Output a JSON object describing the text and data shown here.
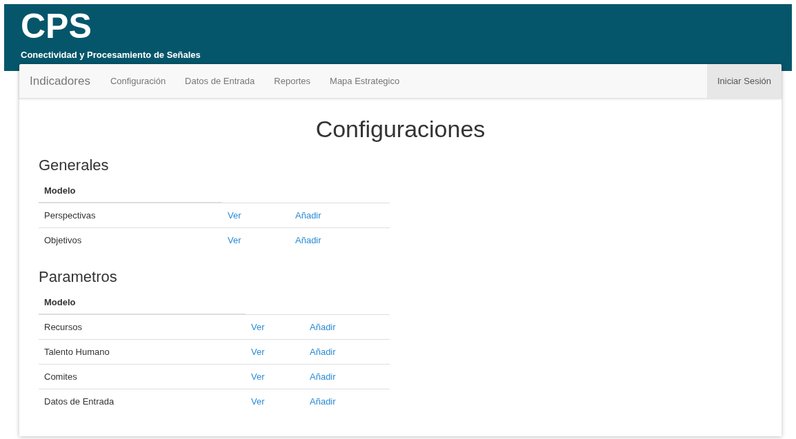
{
  "header": {
    "logo": "CPS",
    "subtitle": "Conectividad y Procesamiento de Señales"
  },
  "navbar": {
    "brand": "Indicadores",
    "items": [
      {
        "label": "Configuración",
        "selected": false
      },
      {
        "label": "Datos de Entrada",
        "selected": false
      },
      {
        "label": "Reportes",
        "selected": false
      },
      {
        "label": "Mapa Estrategico",
        "selected": false
      }
    ],
    "login": {
      "label": "Iniciar Sesión",
      "selected": true
    }
  },
  "page_title": "Configuraciones",
  "sections": [
    {
      "title": "Generales",
      "column": "Modelo",
      "rows": [
        {
          "name": "Perspectivas",
          "view": "Ver",
          "add": "Añadir"
        },
        {
          "name": "Objetivos",
          "view": "Ver",
          "add": "Añadir"
        }
      ]
    },
    {
      "title": "Parametros",
      "column": "Modelo",
      "rows": [
        {
          "name": "Recursos",
          "view": "Ver",
          "add": "Añadir"
        },
        {
          "name": "Talento Humano",
          "view": "Ver",
          "add": "Añadir"
        },
        {
          "name": "Comites",
          "view": "Ver",
          "add": "Añadir"
        },
        {
          "name": "Datos de Entrada",
          "view": "Ver",
          "add": "Añadir"
        }
      ]
    }
  ]
}
